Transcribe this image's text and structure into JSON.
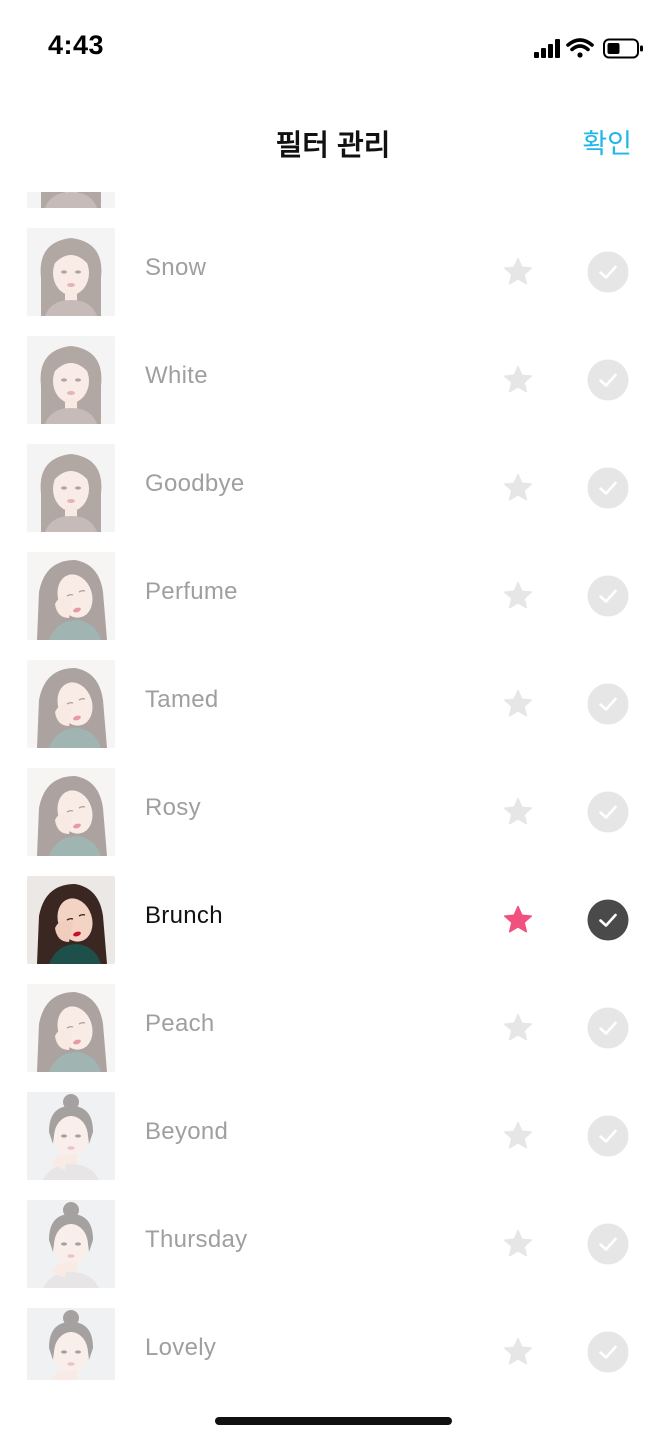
{
  "status_bar": {
    "time": "4:43",
    "icons": [
      "signal-icon",
      "wifi-icon",
      "battery-icon"
    ]
  },
  "nav": {
    "title": "필터 관리",
    "confirm_label": "확인"
  },
  "colors": {
    "accent": "#1fb6e8",
    "favorite_star": "#f2517f",
    "inactive_icon": "#e6e6e6",
    "active_check_bg": "#4a4a4a",
    "inactive_text": "#9f9f9f",
    "active_text": "#111111"
  },
  "filters": [
    {
      "name": "",
      "favorite": false,
      "enabled": false,
      "thumb": "front"
    },
    {
      "name": "Snow",
      "favorite": false,
      "enabled": false,
      "thumb": "front"
    },
    {
      "name": "White",
      "favorite": false,
      "enabled": false,
      "thumb": "front"
    },
    {
      "name": "Goodbye",
      "favorite": false,
      "enabled": false,
      "thumb": "front"
    },
    {
      "name": "Perfume",
      "favorite": false,
      "enabled": false,
      "thumb": "tilt"
    },
    {
      "name": "Tamed",
      "favorite": false,
      "enabled": false,
      "thumb": "tilt"
    },
    {
      "name": "Rosy",
      "favorite": false,
      "enabled": false,
      "thumb": "tilt"
    },
    {
      "name": "Brunch",
      "favorite": true,
      "enabled": true,
      "thumb": "tilt"
    },
    {
      "name": "Peach",
      "favorite": false,
      "enabled": false,
      "thumb": "tilt"
    },
    {
      "name": "Beyond",
      "favorite": false,
      "enabled": false,
      "thumb": "bun"
    },
    {
      "name": "Thursday",
      "favorite": false,
      "enabled": false,
      "thumb": "bun"
    },
    {
      "name": "Lovely",
      "favorite": false,
      "enabled": false,
      "thumb": "bun"
    }
  ]
}
